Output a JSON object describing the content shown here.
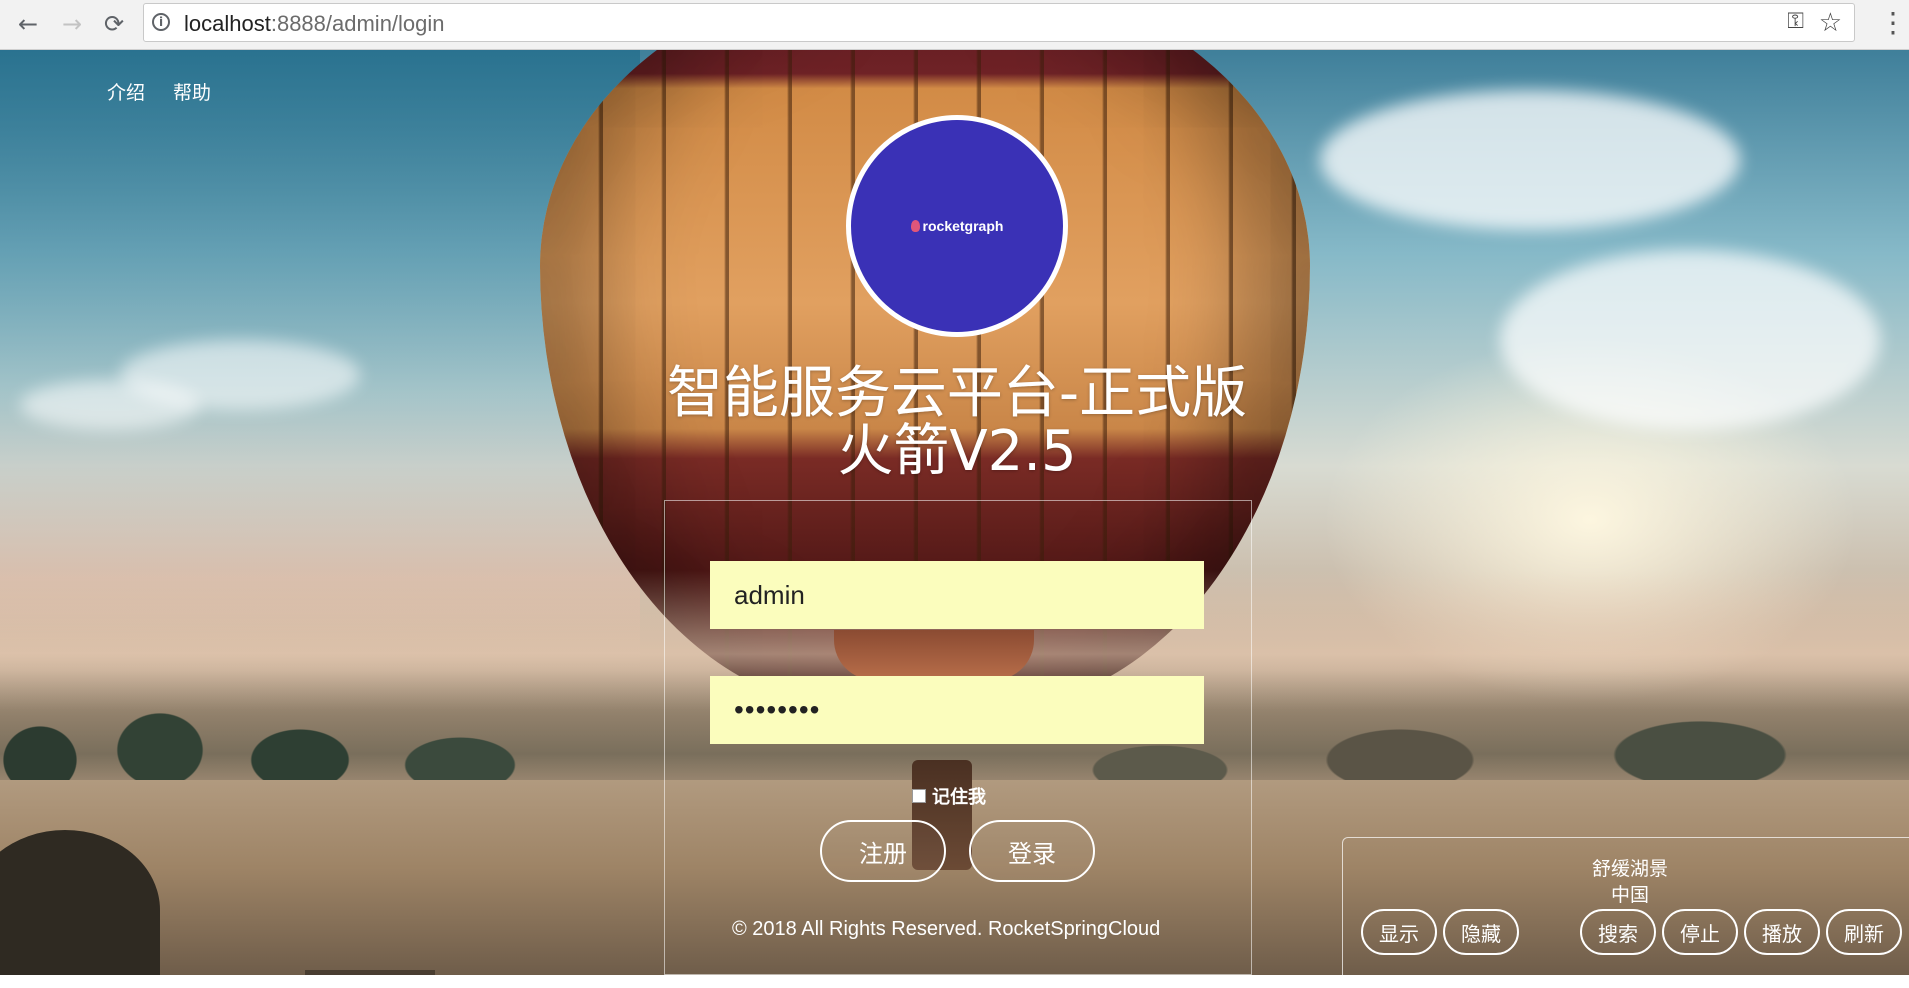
{
  "browser": {
    "url_host": "localhost",
    "url_rest": ":8888/admin/login",
    "back_icon": "←",
    "forward_icon": "→",
    "reload_icon": "⟳",
    "info_icon": "i",
    "key_icon": "⚿",
    "star_icon": "☆",
    "menu_icon": "⋮"
  },
  "nav": {
    "intro": "介绍",
    "help": "帮助"
  },
  "logo": {
    "text": "rocketgraph",
    "bg_color": "#3a31b6"
  },
  "title": {
    "line1": "智能服务云平台-正式版",
    "line2": "火箭V2.5"
  },
  "login": {
    "username": "admin",
    "password_masked": "••••••••",
    "remember_label": "记住我",
    "register_label": "注册",
    "login_label": "登录",
    "input_bg": "#fbfdbd"
  },
  "footer": {
    "copyright": "© 2018 All Rights Reserved. RocketSpringCloud"
  },
  "music": {
    "song_title": "舒缓湖景",
    "song_region": "中国",
    "show_label": "显示",
    "hide_label": "隐藏",
    "search_label": "搜索",
    "stop_label": "停止",
    "play_label": "播放",
    "refresh_label": "刷新"
  }
}
